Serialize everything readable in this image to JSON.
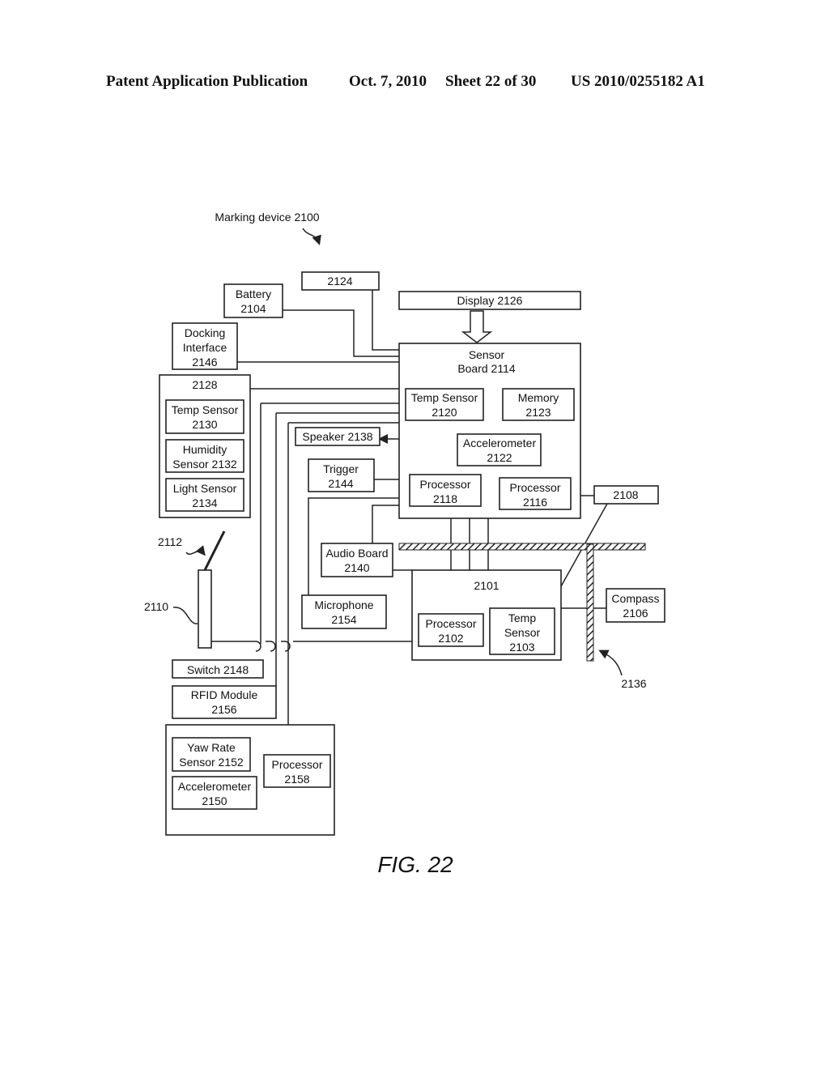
{
  "header": {
    "publication": "Patent Application Publication",
    "date": "Oct. 7, 2010",
    "sheet": "Sheet 22 of 30",
    "number": "US 2010/0255182 A1"
  },
  "figure": {
    "caption": "FIG. 22",
    "title_ref": "Marking device 2100",
    "components": {
      "c2124": [
        "2124"
      ],
      "battery": [
        "Battery",
        "2104"
      ],
      "display": [
        "Display 2126"
      ],
      "docking": [
        "Docking",
        "Interface",
        "2146"
      ],
      "sensor_board": [
        "Sensor",
        "Board 2114"
      ],
      "temp2120": [
        "Temp Sensor",
        "2120"
      ],
      "memory": [
        "Memory",
        "2123"
      ],
      "accel2122": [
        "Accelerometer",
        "2122"
      ],
      "proc2118": [
        "Processor",
        "2118"
      ],
      "proc2116": [
        "Processor",
        "2116"
      ],
      "c2108": [
        "2108"
      ],
      "group2128": [
        "2128"
      ],
      "temp2130": [
        "Temp Sensor",
        "2130"
      ],
      "humidity": [
        "Humidity",
        "Sensor 2132"
      ],
      "light": [
        "Light Sensor",
        "2134"
      ],
      "speaker": [
        "Speaker 2138"
      ],
      "trigger": [
        "Trigger",
        "2144"
      ],
      "audio": [
        "Audio Board",
        "2140"
      ],
      "microphone": [
        "Microphone",
        "2154"
      ],
      "c2101": [
        "2101"
      ],
      "proc2102": [
        "Processor",
        "2102"
      ],
      "temp2103": [
        "Temp",
        "Sensor",
        "2103"
      ],
      "compass": [
        "Compass",
        "2106"
      ],
      "switch": [
        "Switch 2148"
      ],
      "rfid": [
        "RFID Module",
        "2156"
      ],
      "yaw": [
        "Yaw Rate",
        "Sensor 2152"
      ],
      "accel2150": [
        "Accelerometer",
        "2150"
      ],
      "proc2158": [
        "Processor",
        "2158"
      ]
    },
    "callouts": {
      "antenna": "2112",
      "housing": "2110",
      "frame": "2136"
    }
  }
}
